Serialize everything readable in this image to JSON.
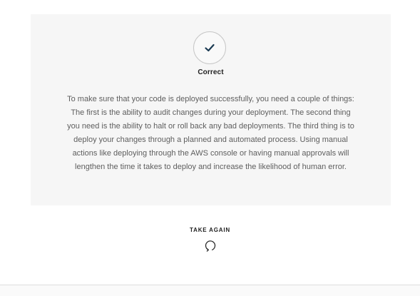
{
  "feedback": {
    "icon": "checkmark-icon",
    "result": "Correct",
    "explanation": "To make sure that your code is deployed successfully, you need a couple of things: The first is the ability to audit changes during your deployment. The second thing you need is the ability to halt or roll back any bad deployments. The third thing is to deploy your changes through a planned and automated process. Using manual actions like deploying through the AWS console or having manual approvals will lengthen the time it takes to deploy and increase the likelihood of human error."
  },
  "actions": {
    "take_again_label": "TAKE AGAIN",
    "take_again_icon": "retry-icon"
  },
  "colors": {
    "card_background": "#f6f6f6",
    "check_color": "#1b3a52",
    "text_muted": "#5e5e5e"
  }
}
